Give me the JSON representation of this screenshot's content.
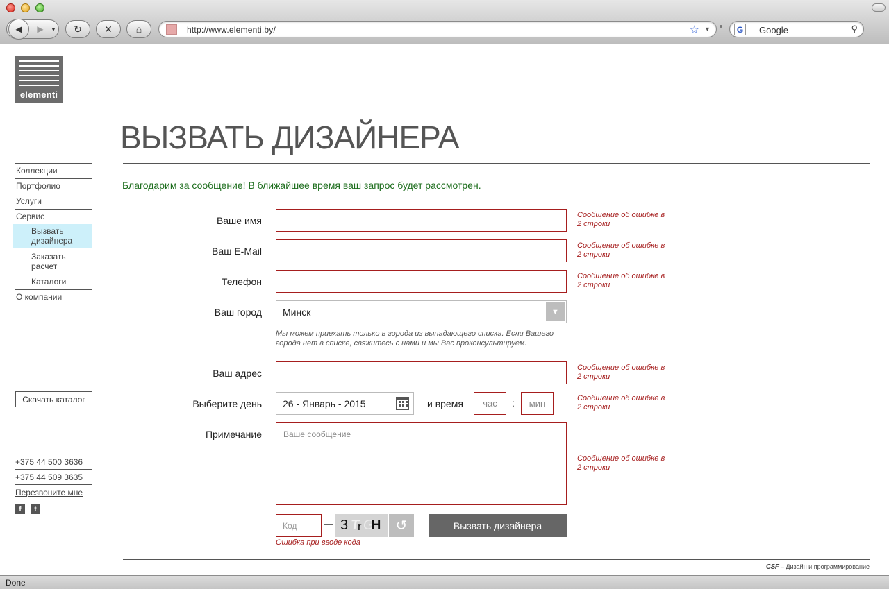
{
  "browser": {
    "url": "http://www.elementi.by/",
    "search_placeholder": "Google",
    "status": "Done"
  },
  "logo": {
    "text": "elementi"
  },
  "page": {
    "title": "ВЫЗВАТЬ ДИЗАЙНЕРА"
  },
  "sidebar": {
    "items": [
      {
        "label": "Коллекции"
      },
      {
        "label": "Портфолио"
      },
      {
        "label": "Услуги"
      },
      {
        "label": "Сервис"
      }
    ],
    "service_sub": [
      {
        "label": "Вызвать дизайнера"
      },
      {
        "label": "Заказать расчет"
      },
      {
        "label": "Каталоги"
      }
    ],
    "about": "О компании",
    "download_catalog": "Скачать каталог",
    "phones": [
      "+375 44 500 3636",
      "+375 44 509 3635"
    ],
    "callback": "Перезвоните мне",
    "social": {
      "facebook": "f",
      "twitter": "t"
    }
  },
  "form": {
    "success_message": "Благодарим за сообщение! В ближайшее время ваш запрос будет рассмотрен.",
    "error_text": "Сообщение об ошибке в 2 строки",
    "name_label": "Ваше имя",
    "email_label": "Ваш E-Mail",
    "phone_label": "Телефон",
    "city_label": "Ваш город",
    "city_value": "Минск",
    "city_hint": "Мы можем приехать только в города из выпадающего списка. Если Вашего города нет в списке, свяжитесь с нами и мы Вас проконсультируем.",
    "address_label": "Ваш адрес",
    "day_label": "Выберите день",
    "day_value": "26 - Январь - 2015",
    "time_label": "и время",
    "hour_placeholder": "час",
    "minute_placeholder": "мин",
    "colon": ":",
    "note_label": "Примечание",
    "note_placeholder": "Ваше сообщение",
    "code_placeholder": "Код",
    "captcha": [
      "3",
      "T",
      "r",
      "G",
      "H"
    ],
    "submit": "Вызвать дизайнера",
    "code_error": "Ошибка при вводе кода"
  },
  "footer": {
    "credit_brand": "CSF",
    "credit_text": " – Дизайн и программирование"
  }
}
